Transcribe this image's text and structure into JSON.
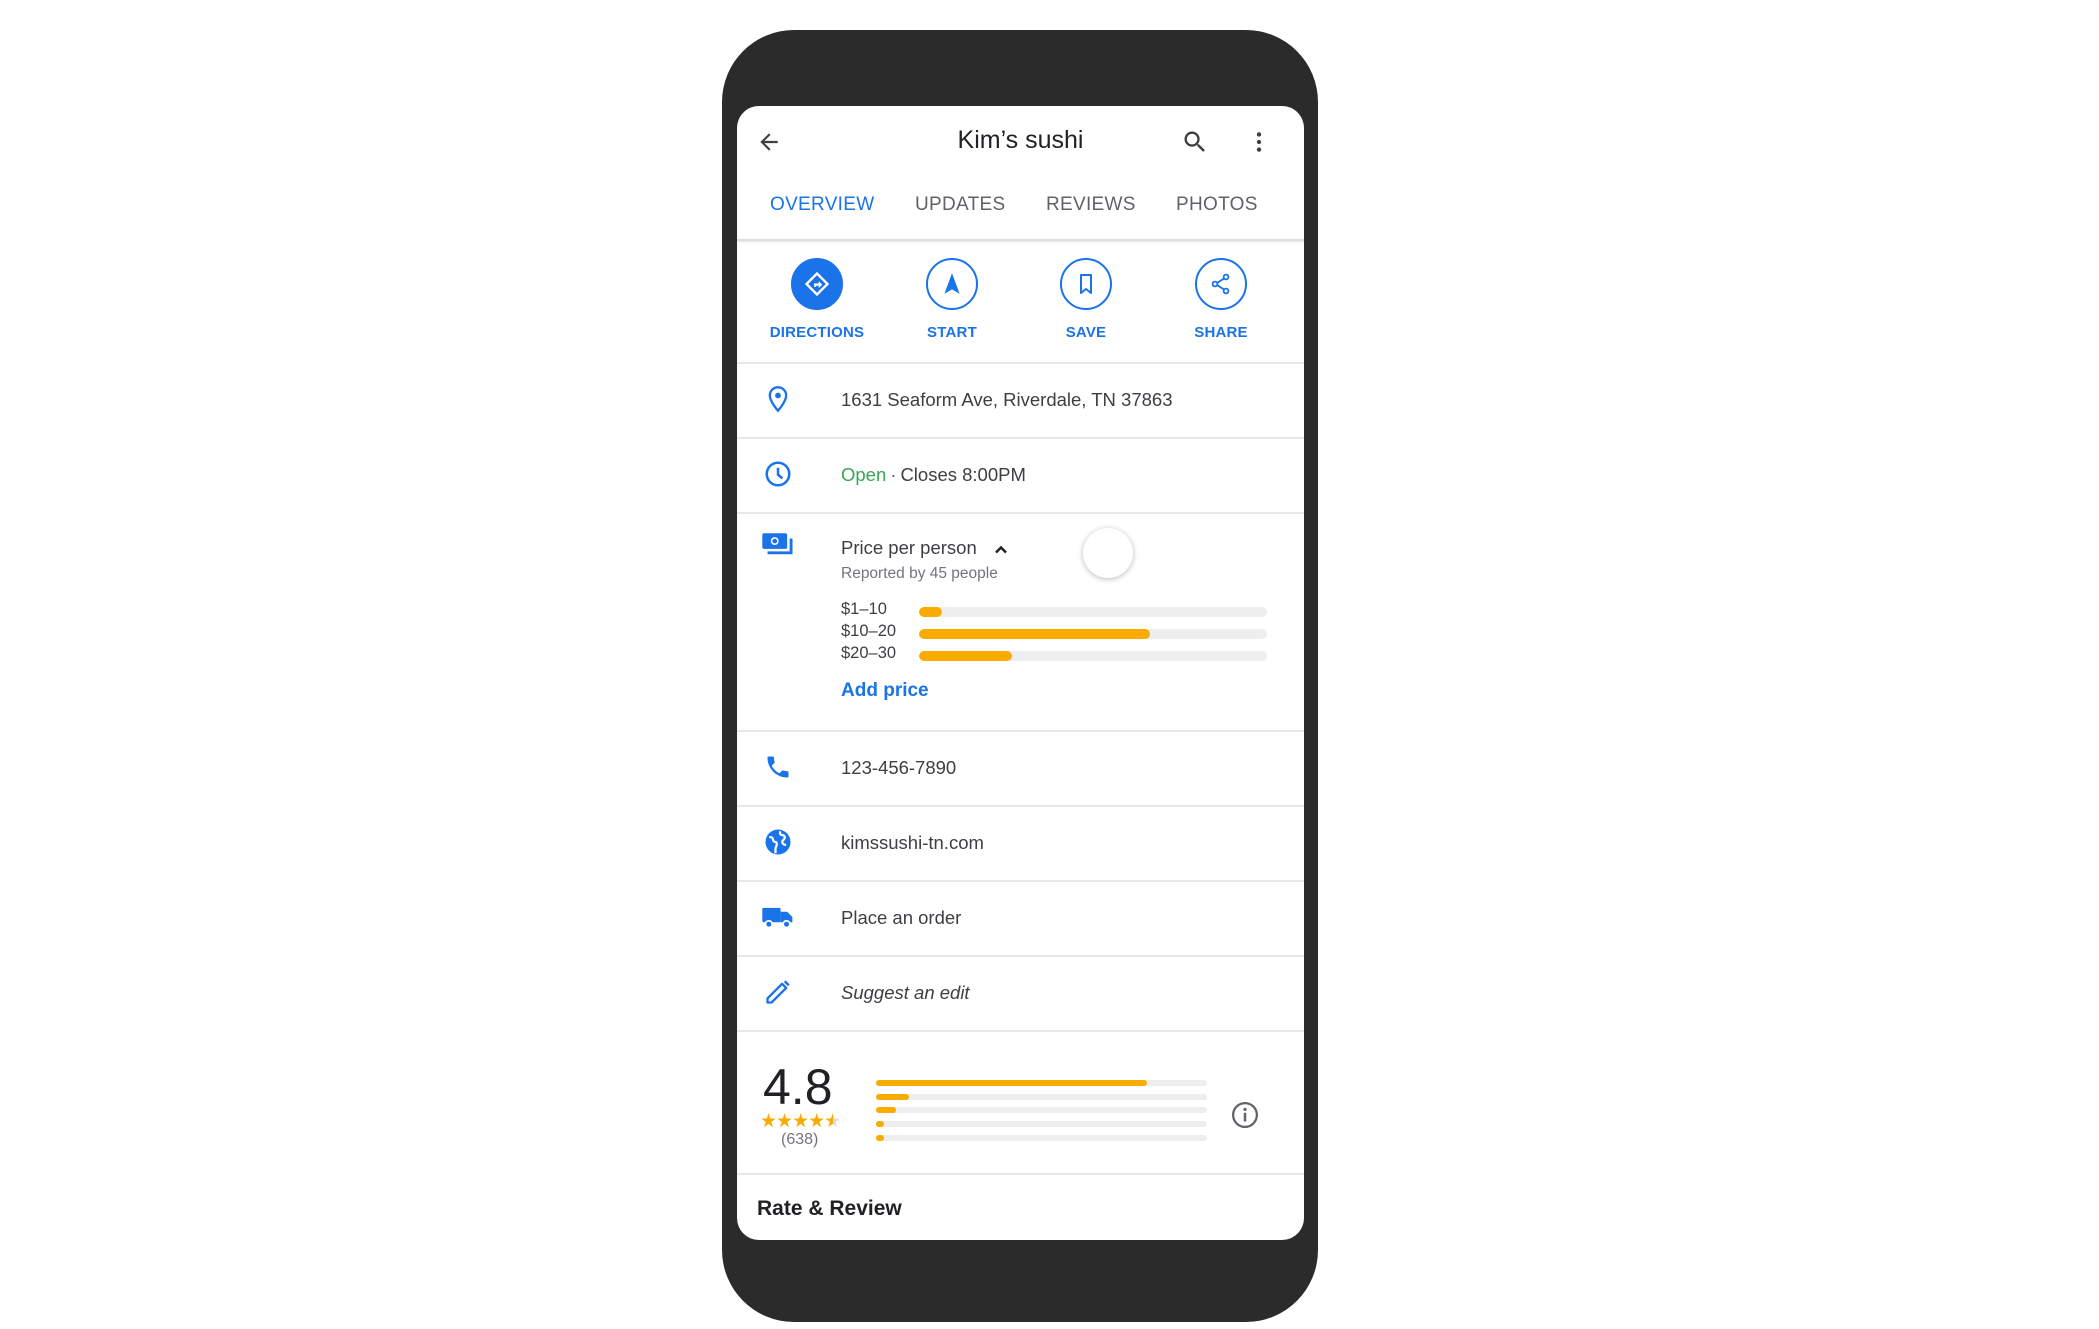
{
  "header": {
    "title": "Kim’s sushi",
    "back_icon": "arrow-back-icon",
    "search_icon": "search-icon",
    "more_icon": "more-vert-icon"
  },
  "tabs": [
    {
      "label": "OVERVIEW",
      "active": true
    },
    {
      "label": "UPDATES",
      "active": false
    },
    {
      "label": "REVIEWS",
      "active": false
    },
    {
      "label": "PHOTOS",
      "active": false
    }
  ],
  "actions": [
    {
      "label": "DIRECTIONS",
      "icon": "directions-icon"
    },
    {
      "label": "START",
      "icon": "navigation-icon"
    },
    {
      "label": "SAVE",
      "icon": "bookmark-icon"
    },
    {
      "label": "SHARE",
      "icon": "share-icon"
    }
  ],
  "details": {
    "address": "1631 Seaform Ave, Riverdale, TN 37863",
    "hours_status": "Open",
    "hours_separator": "·",
    "hours_close": "Closes 8:00PM",
    "phone": "123-456-7890",
    "website": "kimssushi-tn.com",
    "order": "Place an order",
    "suggest_edit": "Suggest an edit"
  },
  "price": {
    "title": "Price per person",
    "reported": "Reported by 45 people",
    "ranges": [
      {
        "label": "$1–10",
        "share": 0.066
      },
      {
        "label": "$10–20",
        "share": 0.665
      },
      {
        "label": "$20–30",
        "share": 0.267
      }
    ],
    "add_price": "Add price"
  },
  "rating": {
    "score": "4.8",
    "stars_text": "★★★★",
    "half_star": "★",
    "count": "(638)",
    "distribution": [
      {
        "stars": 5,
        "share": 0.82
      },
      {
        "stars": 4,
        "share": 0.1
      },
      {
        "stars": 3,
        "share": 0.06
      },
      {
        "stars": 2,
        "share": 0.02
      },
      {
        "stars": 1,
        "share": 0.02
      }
    ]
  },
  "rate_review": "Rate & Review",
  "colors": {
    "accent": "#1a73e8",
    "bar": "#f9ab00",
    "open": "#34a853"
  }
}
